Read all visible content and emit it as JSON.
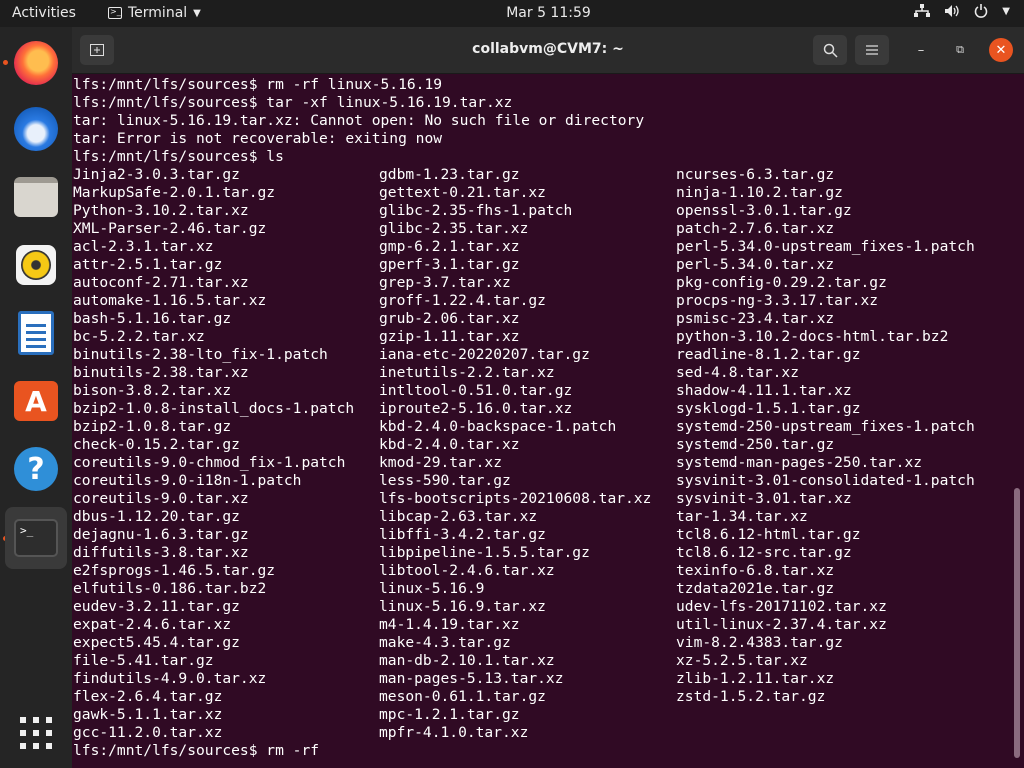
{
  "topbar": {
    "activities": "Activities",
    "app_name": "Terminal",
    "datetime": "Mar 5  11:59"
  },
  "dock": {
    "items": [
      "firefox-icon",
      "thunderbird-icon",
      "files-icon",
      "rhythmbox-icon",
      "writer-icon",
      "software-icon",
      "help-icon",
      "terminal-icon",
      "app-grid-icon"
    ]
  },
  "window": {
    "title": "collabvm@CVM7: ~"
  },
  "terminal": {
    "lines": [
      "lfs:/mnt/lfs/sources$ rm -rf linux-5.16.19",
      "lfs:/mnt/lfs/sources$ tar -xf linux-5.16.19.tar.xz",
      "tar: linux-5.16.19.tar.xz: Cannot open: No such file or directory",
      "tar: Error is not recoverable: exiting now",
      "lfs:/mnt/lfs/sources$ ls"
    ],
    "ls_columns": [
      [
        "Jinja2-3.0.3.tar.gz",
        "MarkupSafe-2.0.1.tar.gz",
        "Python-3.10.2.tar.xz",
        "XML-Parser-2.46.tar.gz",
        "acl-2.3.1.tar.xz",
        "attr-2.5.1.tar.gz",
        "autoconf-2.71.tar.xz",
        "automake-1.16.5.tar.xz",
        "bash-5.1.16.tar.gz",
        "bc-5.2.2.tar.xz",
        "binutils-2.38-lto_fix-1.patch",
        "binutils-2.38.tar.xz",
        "bison-3.8.2.tar.xz",
        "bzip2-1.0.8-install_docs-1.patch",
        "bzip2-1.0.8.tar.gz",
        "check-0.15.2.tar.gz",
        "coreutils-9.0-chmod_fix-1.patch",
        "coreutils-9.0-i18n-1.patch",
        "coreutils-9.0.tar.xz",
        "dbus-1.12.20.tar.gz",
        "dejagnu-1.6.3.tar.gz",
        "diffutils-3.8.tar.xz",
        "e2fsprogs-1.46.5.tar.gz",
        "elfutils-0.186.tar.bz2",
        "eudev-3.2.11.tar.gz",
        "expat-2.4.6.tar.xz",
        "expect5.45.4.tar.gz",
        "file-5.41.tar.gz",
        "findutils-4.9.0.tar.xz",
        "flex-2.6.4.tar.gz",
        "gawk-5.1.1.tar.xz",
        "gcc-11.2.0.tar.xz"
      ],
      [
        "gdbm-1.23.tar.gz",
        "gettext-0.21.tar.xz",
        "glibc-2.35-fhs-1.patch",
        "glibc-2.35.tar.xz",
        "gmp-6.2.1.tar.xz",
        "gperf-3.1.tar.gz",
        "grep-3.7.tar.xz",
        "groff-1.22.4.tar.gz",
        "grub-2.06.tar.xz",
        "gzip-1.11.tar.xz",
        "iana-etc-20220207.tar.gz",
        "inetutils-2.2.tar.xz",
        "intltool-0.51.0.tar.gz",
        "iproute2-5.16.0.tar.xz",
        "kbd-2.4.0-backspace-1.patch",
        "kbd-2.4.0.tar.xz",
        "kmod-29.tar.xz",
        "less-590.tar.gz",
        "lfs-bootscripts-20210608.tar.xz",
        "libcap-2.63.tar.xz",
        "libffi-3.4.2.tar.gz",
        "libpipeline-1.5.5.tar.gz",
        "libtool-2.4.6.tar.xz",
        "linux-5.16.9",
        "linux-5.16.9.tar.xz",
        "m4-1.4.19.tar.xz",
        "make-4.3.tar.gz",
        "man-db-2.10.1.tar.xz",
        "man-pages-5.13.tar.xz",
        "meson-0.61.1.tar.gz",
        "mpc-1.2.1.tar.gz",
        "mpfr-4.1.0.tar.xz"
      ],
      [
        "ncurses-6.3.tar.gz",
        "ninja-1.10.2.tar.gz",
        "openssl-3.0.1.tar.gz",
        "patch-2.7.6.tar.xz",
        "perl-5.34.0-upstream_fixes-1.patch",
        "perl-5.34.0.tar.xz",
        "pkg-config-0.29.2.tar.gz",
        "procps-ng-3.3.17.tar.xz",
        "psmisc-23.4.tar.xz",
        "python-3.10.2-docs-html.tar.bz2",
        "readline-8.1.2.tar.gz",
        "sed-4.8.tar.xz",
        "shadow-4.11.1.tar.xz",
        "sysklogd-1.5.1.tar.gz",
        "systemd-250-upstream_fixes-1.patch",
        "systemd-250.tar.gz",
        "systemd-man-pages-250.tar.xz",
        "sysvinit-3.01-consolidated-1.patch",
        "sysvinit-3.01.tar.xz",
        "tar-1.34.tar.xz",
        "tcl8.6.12-html.tar.gz",
        "tcl8.6.12-src.tar.gz",
        "texinfo-6.8.tar.xz",
        "tzdata2021e.tar.gz",
        "udev-lfs-20171102.tar.xz",
        "util-linux-2.37.4.tar.xz",
        "vim-8.2.4383.tar.gz",
        "xz-5.2.5.tar.xz",
        "zlib-1.2.11.tar.xz",
        "zstd-1.5.2.tar.gz"
      ]
    ],
    "prompt_line": "lfs:/mnt/lfs/sources$ rm -rf "
  }
}
